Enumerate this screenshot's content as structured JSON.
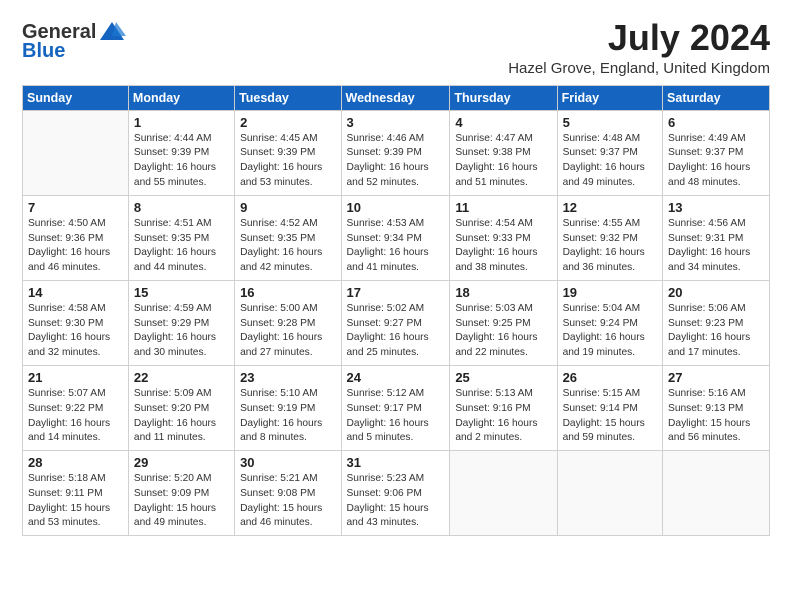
{
  "header": {
    "logo_general": "General",
    "logo_blue": "Blue",
    "month_title": "July 2024",
    "location": "Hazel Grove, England, United Kingdom"
  },
  "weekdays": [
    "Sunday",
    "Monday",
    "Tuesday",
    "Wednesday",
    "Thursday",
    "Friday",
    "Saturday"
  ],
  "weeks": [
    [
      {
        "day": "",
        "info": ""
      },
      {
        "day": "1",
        "info": "Sunrise: 4:44 AM\nSunset: 9:39 PM\nDaylight: 16 hours\nand 55 minutes."
      },
      {
        "day": "2",
        "info": "Sunrise: 4:45 AM\nSunset: 9:39 PM\nDaylight: 16 hours\nand 53 minutes."
      },
      {
        "day": "3",
        "info": "Sunrise: 4:46 AM\nSunset: 9:39 PM\nDaylight: 16 hours\nand 52 minutes."
      },
      {
        "day": "4",
        "info": "Sunrise: 4:47 AM\nSunset: 9:38 PM\nDaylight: 16 hours\nand 51 minutes."
      },
      {
        "day": "5",
        "info": "Sunrise: 4:48 AM\nSunset: 9:37 PM\nDaylight: 16 hours\nand 49 minutes."
      },
      {
        "day": "6",
        "info": "Sunrise: 4:49 AM\nSunset: 9:37 PM\nDaylight: 16 hours\nand 48 minutes."
      }
    ],
    [
      {
        "day": "7",
        "info": "Sunrise: 4:50 AM\nSunset: 9:36 PM\nDaylight: 16 hours\nand 46 minutes."
      },
      {
        "day": "8",
        "info": "Sunrise: 4:51 AM\nSunset: 9:35 PM\nDaylight: 16 hours\nand 44 minutes."
      },
      {
        "day": "9",
        "info": "Sunrise: 4:52 AM\nSunset: 9:35 PM\nDaylight: 16 hours\nand 42 minutes."
      },
      {
        "day": "10",
        "info": "Sunrise: 4:53 AM\nSunset: 9:34 PM\nDaylight: 16 hours\nand 41 minutes."
      },
      {
        "day": "11",
        "info": "Sunrise: 4:54 AM\nSunset: 9:33 PM\nDaylight: 16 hours\nand 38 minutes."
      },
      {
        "day": "12",
        "info": "Sunrise: 4:55 AM\nSunset: 9:32 PM\nDaylight: 16 hours\nand 36 minutes."
      },
      {
        "day": "13",
        "info": "Sunrise: 4:56 AM\nSunset: 9:31 PM\nDaylight: 16 hours\nand 34 minutes."
      }
    ],
    [
      {
        "day": "14",
        "info": "Sunrise: 4:58 AM\nSunset: 9:30 PM\nDaylight: 16 hours\nand 32 minutes."
      },
      {
        "day": "15",
        "info": "Sunrise: 4:59 AM\nSunset: 9:29 PM\nDaylight: 16 hours\nand 30 minutes."
      },
      {
        "day": "16",
        "info": "Sunrise: 5:00 AM\nSunset: 9:28 PM\nDaylight: 16 hours\nand 27 minutes."
      },
      {
        "day": "17",
        "info": "Sunrise: 5:02 AM\nSunset: 9:27 PM\nDaylight: 16 hours\nand 25 minutes."
      },
      {
        "day": "18",
        "info": "Sunrise: 5:03 AM\nSunset: 9:25 PM\nDaylight: 16 hours\nand 22 minutes."
      },
      {
        "day": "19",
        "info": "Sunrise: 5:04 AM\nSunset: 9:24 PM\nDaylight: 16 hours\nand 19 minutes."
      },
      {
        "day": "20",
        "info": "Sunrise: 5:06 AM\nSunset: 9:23 PM\nDaylight: 16 hours\nand 17 minutes."
      }
    ],
    [
      {
        "day": "21",
        "info": "Sunrise: 5:07 AM\nSunset: 9:22 PM\nDaylight: 16 hours\nand 14 minutes."
      },
      {
        "day": "22",
        "info": "Sunrise: 5:09 AM\nSunset: 9:20 PM\nDaylight: 16 hours\nand 11 minutes."
      },
      {
        "day": "23",
        "info": "Sunrise: 5:10 AM\nSunset: 9:19 PM\nDaylight: 16 hours\nand 8 minutes."
      },
      {
        "day": "24",
        "info": "Sunrise: 5:12 AM\nSunset: 9:17 PM\nDaylight: 16 hours\nand 5 minutes."
      },
      {
        "day": "25",
        "info": "Sunrise: 5:13 AM\nSunset: 9:16 PM\nDaylight: 16 hours\nand 2 minutes."
      },
      {
        "day": "26",
        "info": "Sunrise: 5:15 AM\nSunset: 9:14 PM\nDaylight: 15 hours\nand 59 minutes."
      },
      {
        "day": "27",
        "info": "Sunrise: 5:16 AM\nSunset: 9:13 PM\nDaylight: 15 hours\nand 56 minutes."
      }
    ],
    [
      {
        "day": "28",
        "info": "Sunrise: 5:18 AM\nSunset: 9:11 PM\nDaylight: 15 hours\nand 53 minutes."
      },
      {
        "day": "29",
        "info": "Sunrise: 5:20 AM\nSunset: 9:09 PM\nDaylight: 15 hours\nand 49 minutes."
      },
      {
        "day": "30",
        "info": "Sunrise: 5:21 AM\nSunset: 9:08 PM\nDaylight: 15 hours\nand 46 minutes."
      },
      {
        "day": "31",
        "info": "Sunrise: 5:23 AM\nSunset: 9:06 PM\nDaylight: 15 hours\nand 43 minutes."
      },
      {
        "day": "",
        "info": ""
      },
      {
        "day": "",
        "info": ""
      },
      {
        "day": "",
        "info": ""
      }
    ]
  ]
}
